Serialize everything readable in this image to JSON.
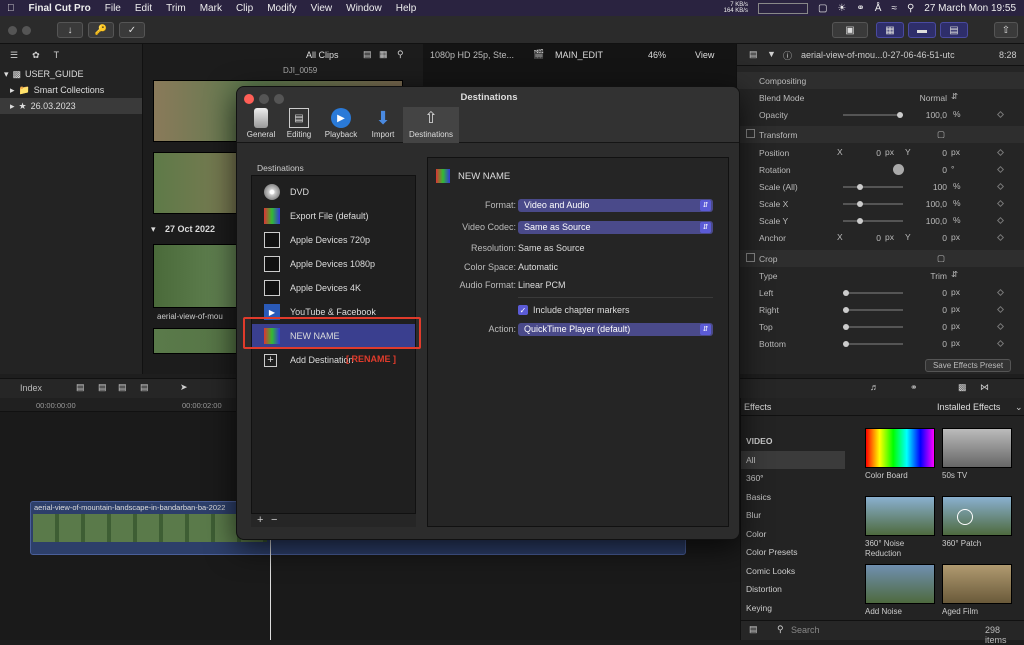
{
  "menubar": {
    "app": "Final Cut Pro",
    "items": [
      "File",
      "Edit",
      "Trim",
      "Mark",
      "Clip",
      "Modify",
      "View",
      "Window",
      "Help"
    ],
    "net_up": "7 KB/s",
    "net_down": "164 KB/s",
    "datetime": "27 March Mon  19:55"
  },
  "libraries": {
    "rows": [
      {
        "label": "USER_GUIDE"
      },
      {
        "label": "Smart Collections"
      },
      {
        "label": "26.03.2023"
      }
    ]
  },
  "browser": {
    "filter": "All Clips",
    "clip_top": "DJI_0059",
    "date_header": "27 Oct 2022",
    "clip_label": "aerial-view-of-mou"
  },
  "viewer": {
    "format": "1080p HD 25p, Ste...",
    "project": "MAIN_EDIT",
    "zoom": "46%",
    "view_menu": "View"
  },
  "inspector": {
    "title": "aerial-view-of-mou...0-27-06-46-51-utc",
    "duration": "8:28",
    "compositing": "Compositing",
    "blend_label": "Blend Mode",
    "blend_value": "Normal",
    "opacity_label": "Opacity",
    "opacity_value": "100,0",
    "transform": "Transform",
    "position_label": "Position",
    "x": "X",
    "y": "Y",
    "pos_x": "0",
    "pos_y": "0",
    "px": "px",
    "pct": "%",
    "deg": "°",
    "rotation_label": "Rotation",
    "rotation_value": "0",
    "scale_all_label": "Scale (All)",
    "scale_all_value": "100",
    "scale_x_label": "Scale X",
    "scale_x_value": "100,0",
    "scale_y_label": "Scale Y",
    "scale_y_value": "100,0",
    "anchor_label": "Anchor",
    "anchor_x": "0",
    "anchor_y": "0",
    "crop": "Crop",
    "type_label": "Type",
    "type_value": "Trim",
    "left_label": "Left",
    "right_label": "Right",
    "top_label": "Top",
    "bottom_label": "Bottom",
    "crop_value": "0",
    "save_preset": "Save Effects Preset"
  },
  "timeline": {
    "index": "Index",
    "tc_start": "00:00:00:00",
    "tc_2": "00:00:02:00",
    "clip_name": "aerial-view-of-mountain-landscape-in-bandarban-ba-2022"
  },
  "effects": {
    "title": "Effects",
    "installed": "Installed Effects",
    "section": "VIDEO",
    "categories": [
      "All",
      "360°",
      "Basics",
      "Blur",
      "Color",
      "Color Presets",
      "Comic Looks",
      "Distortion",
      "Keying"
    ],
    "items": [
      "Color Board",
      "50s TV",
      "360° Noise Reduction",
      "360° Patch",
      "Add Noise",
      "Aged Film"
    ],
    "search_placeholder": "Search",
    "count": "298 items"
  },
  "dialog": {
    "title": "Destinations",
    "tabs": [
      "General",
      "Editing",
      "Playback",
      "Import",
      "Destinations"
    ],
    "list_header": "Destinations",
    "destinations": [
      "DVD",
      "Export File (default)",
      "Apple Devices 720p",
      "Apple Devices 1080p",
      "Apple Devices 4K",
      "YouTube & Facebook",
      "NEW NAME",
      "Add Destination"
    ],
    "rename_annotation": "[ RENAME ]",
    "add": "+",
    "remove": "−",
    "detail_name": "NEW NAME",
    "format_label": "Format:",
    "format_value": "Video and Audio",
    "codec_label": "Video Codec:",
    "codec_value": "Same as Source",
    "resolution_label": "Resolution:",
    "resolution_value": "Same as Source",
    "colorspace_label": "Color Space:",
    "colorspace_value": "Automatic",
    "audio_label": "Audio Format:",
    "audio_value": "Linear PCM",
    "chapter_label": "Include chapter markers",
    "action_label": "Action:",
    "action_value": "QuickTime Player (default)",
    "colors": {
      "accent": "#5b5bd6",
      "highlight": "#e03b2b",
      "selected_row": "#3a3f8f"
    }
  }
}
